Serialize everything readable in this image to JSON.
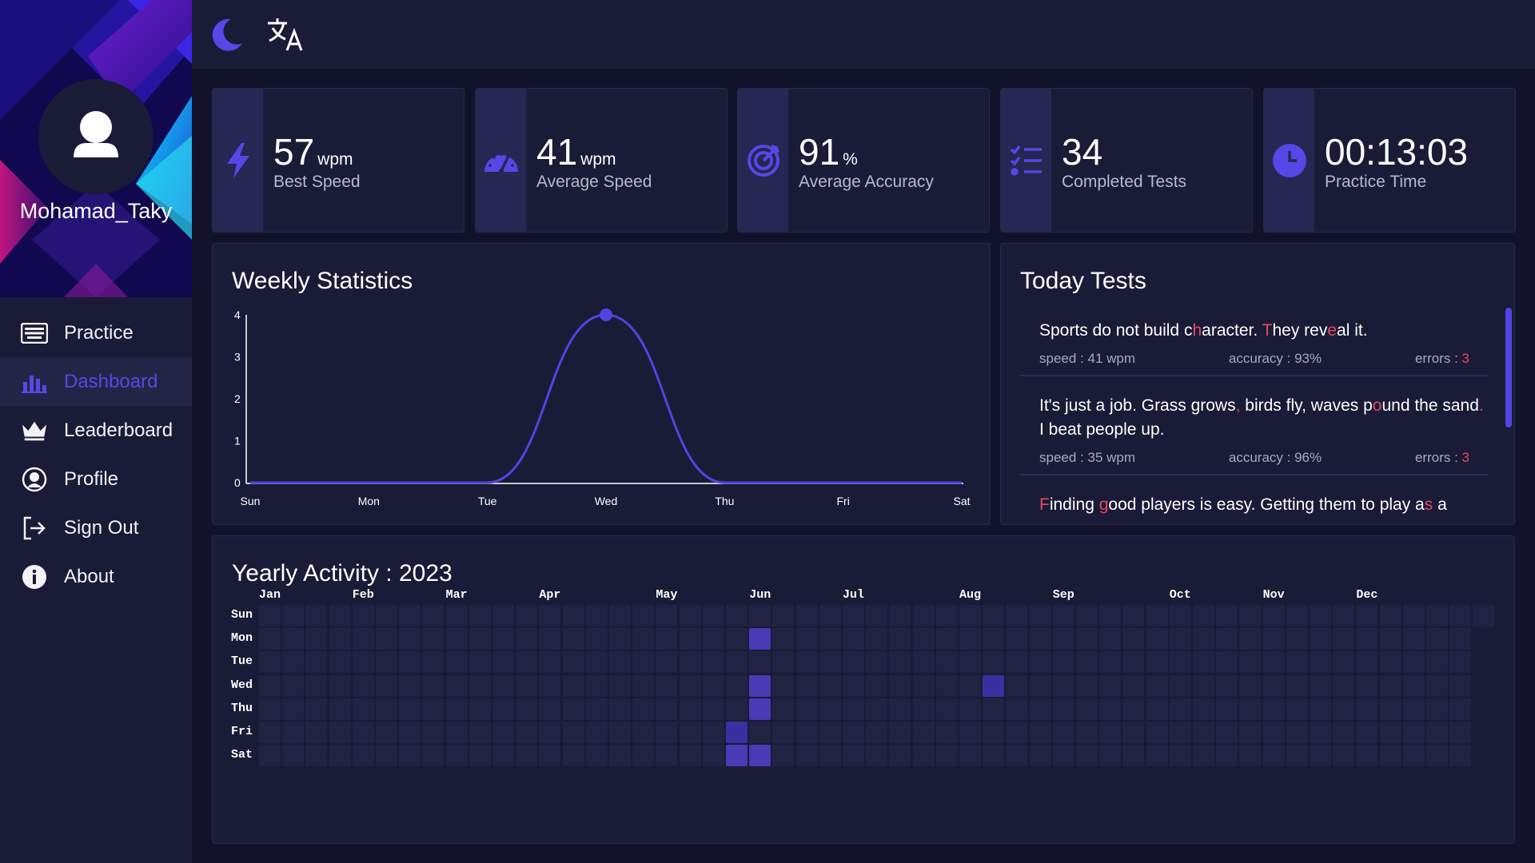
{
  "app": {
    "username": "Mohamad_Taky"
  },
  "topbar": {
    "icons": [
      "moon-icon",
      "translate-icon"
    ]
  },
  "nav": [
    {
      "label": "Practice",
      "icon": "keyboard-icon",
      "active": false
    },
    {
      "label": "Dashboard",
      "icon": "bar-chart-icon",
      "active": true
    },
    {
      "label": "Leaderboard",
      "icon": "crown-icon",
      "active": false
    },
    {
      "label": "Profile",
      "icon": "user-circle-icon",
      "active": false
    },
    {
      "label": "Sign Out",
      "icon": "sign-out-icon",
      "active": false
    },
    {
      "label": "About",
      "icon": "info-icon",
      "active": false
    }
  ],
  "stats": [
    {
      "value": "57",
      "unit": "wpm",
      "label": "Best Speed",
      "icon": "bolt-icon"
    },
    {
      "value": "41",
      "unit": "wpm",
      "label": "Average Speed",
      "icon": "gauge-icon"
    },
    {
      "value": "91",
      "unit": "%",
      "label": "Average Accuracy",
      "icon": "target-icon"
    },
    {
      "value": "34",
      "unit": "",
      "label": "Completed Tests",
      "icon": "list-check-icon"
    },
    {
      "value": "00:13:03",
      "unit": "",
      "label": "Practice Time",
      "icon": "clock-icon"
    }
  ],
  "weekly": {
    "title": "Weekly Statistics"
  },
  "chart_data": {
    "type": "line",
    "categories": [
      "Sun",
      "Mon",
      "Tue",
      "Wed",
      "Thu",
      "Fri",
      "Sat"
    ],
    "values": [
      0,
      0,
      0,
      4,
      0,
      0,
      0
    ],
    "title": "Weekly Statistics",
    "xlabel": "",
    "ylabel": "",
    "ylim": [
      0,
      4
    ],
    "yticks": [
      "0",
      "1",
      "2",
      "3",
      "4"
    ],
    "grid": false,
    "color": "#4f45e0"
  },
  "today": {
    "title": "Today Tests",
    "tests": [
      {
        "segments": [
          {
            "t": "Sports do not build c",
            "e": false
          },
          {
            "t": "h",
            "e": true
          },
          {
            "t": "aracter. ",
            "e": false
          },
          {
            "t": "T",
            "e": true
          },
          {
            "t": "hey rev",
            "e": false
          },
          {
            "t": "e",
            "e": true
          },
          {
            "t": "al it.",
            "e": false
          }
        ],
        "speed": "speed : 41 wpm",
        "accuracy": "accuracy : 93%",
        "errors_label": "errors : ",
        "errors": "3"
      },
      {
        "segments": [
          {
            "t": "It's just a job. Grass grows",
            "e": false
          },
          {
            "t": ",",
            "e": true
          },
          {
            "t": " birds fly, waves p",
            "e": false
          },
          {
            "t": "o",
            "e": true
          },
          {
            "t": "und the sand",
            "e": false
          },
          {
            "t": ".",
            "e": true
          },
          {
            "t": " I beat people up.",
            "e": false
          }
        ],
        "speed": "speed : 35 wpm",
        "accuracy": "accuracy : 96%",
        "errors_label": "errors : ",
        "errors": "3"
      },
      {
        "segments": [
          {
            "t": "F",
            "e": true
          },
          {
            "t": "inding ",
            "e": false
          },
          {
            "t": "g",
            "e": true
          },
          {
            "t": "ood players is easy. Getting them to play a",
            "e": false
          },
          {
            "t": "s",
            "e": true
          },
          {
            "t": " a",
            "e": false
          }
        ],
        "speed": "",
        "accuracy": "",
        "errors_label": "",
        "errors": ""
      }
    ]
  },
  "yearly": {
    "title": "Yearly Activity : 2023",
    "months": [
      "Jan",
      "Feb",
      "Mar",
      "Apr",
      "May",
      "Jun",
      "Jul",
      "Aug",
      "Sep",
      "Oct",
      "Nov",
      "Dec"
    ],
    "days": [
      "Sun",
      "Mon",
      "Tue",
      "Wed",
      "Thu",
      "Fri",
      "Sat"
    ],
    "active_cells": [
      {
        "date": "2023-05-26",
        "level": 1
      },
      {
        "date": "2023-05-27",
        "level": 2
      },
      {
        "date": "2023-05-29",
        "level": 2
      },
      {
        "date": "2023-05-31",
        "level": 2
      },
      {
        "date": "2023-06-01",
        "level": 2
      },
      {
        "date": "2023-06-03",
        "level": 2
      },
      {
        "date": "2023-08-09",
        "level": 1
      }
    ]
  }
}
